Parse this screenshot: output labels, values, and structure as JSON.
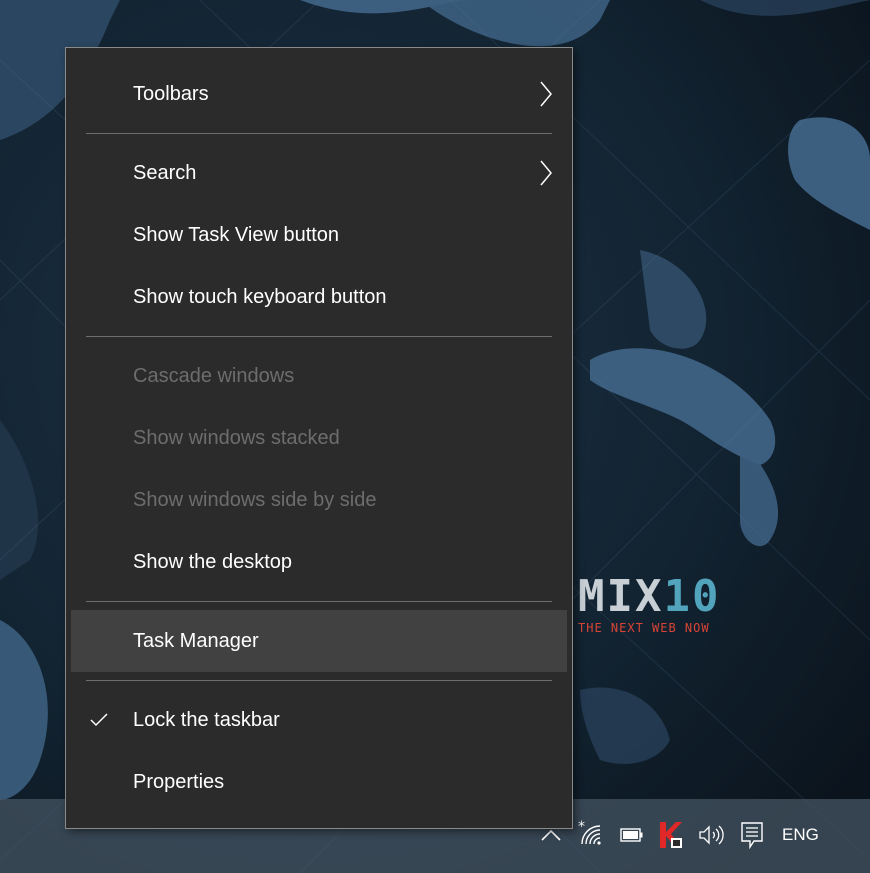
{
  "menu": {
    "items": [
      {
        "label": "Toolbars"
      },
      {
        "label": "Search"
      },
      {
        "label": "Show Task View button"
      },
      {
        "label": "Show touch keyboard button"
      },
      {
        "label": "Cascade windows"
      },
      {
        "label": "Show windows stacked"
      },
      {
        "label": "Show windows side by side"
      },
      {
        "label": "Show the desktop"
      },
      {
        "label": "Task Manager"
      },
      {
        "label": "Lock the taskbar"
      },
      {
        "label": "Properties"
      }
    ]
  },
  "wallpaper": {
    "logo_word": "MIX",
    "logo_number": "10",
    "logo_tagline": "THE NEXT WEB NOW"
  },
  "taskbar": {
    "language": "ENG",
    "icons": [
      "chevron-up-icon",
      "wifi-icon",
      "battery-icon",
      "kaspersky-icon",
      "volume-icon",
      "action-center-icon"
    ]
  },
  "colors": {
    "menu_background": "#2b2b2b",
    "menu_highlight": "#414141",
    "menu_text": "#ffffff",
    "menu_disabled_text": "#6d6d6d",
    "menu_border": "#8a8a8a",
    "wallpaper_base": "#0f1b26",
    "wallpaper_shape": "#3c5f80",
    "logo_accent": "#52a3bc",
    "tagline": "#d94436",
    "kaspersky": "#e02828"
  }
}
